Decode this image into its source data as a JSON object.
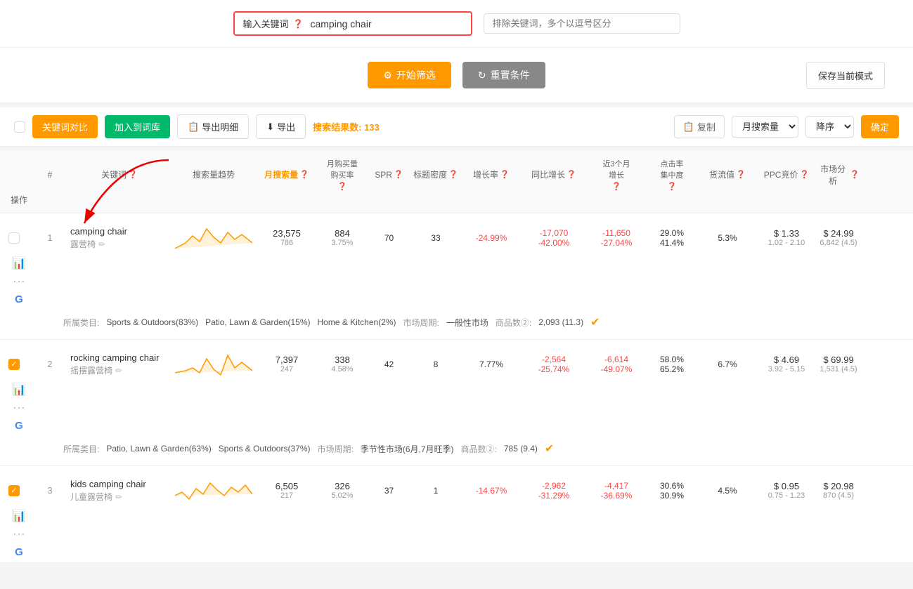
{
  "search": {
    "label": "输入关键词",
    "value": "camping chair",
    "exclude_placeholder": "排除关键词，多个以逗号区分"
  },
  "buttons": {
    "filter": "开始筛选",
    "reset": "重置条件",
    "save": "保存当前模式",
    "compare": "关键词对比",
    "add_vocab": "加入到词库",
    "export_detail": "导出明细",
    "export": "导出",
    "copy": "复制",
    "confirm": "确定",
    "filter_icon": "⚙",
    "reset_icon": "↻"
  },
  "toolbar": {
    "search_count_label": "搜索结果数:",
    "search_count": "133",
    "sort_by": "月搜索量",
    "order": "降序"
  },
  "table": {
    "headers": [
      "#",
      "关键词",
      "搜索量趋势",
      "月搜索量",
      "月购买量购买率",
      "SPR",
      "标题密度",
      "增长率",
      "同比增长",
      "近3个月增长",
      "点击集中度",
      "货流值",
      "PPC竞价",
      "市场分析",
      "操作"
    ],
    "rows": [
      {
        "id": 1,
        "checked": false,
        "keyword_en": "camping chair",
        "keyword_cn": "露营椅",
        "search_vol_main": "23,575",
        "search_vol_sub": "786",
        "buy_vol": "884",
        "buy_rate": "3.75%",
        "spr": "70",
        "title_density": "33",
        "growth_rate": "-24.99%",
        "yoy_main": "-17,070",
        "yoy_sub": "-42.00%",
        "q3_main": "-11,650",
        "q3_sub": "-27.04%",
        "click_concentration": "29.0%",
        "click_sub": "41.4%",
        "flow_val": "5.3%",
        "ppc_main": "$ 1.33",
        "ppc_range": "1.02 - 2.10",
        "market_main": "$ 24.99",
        "market_sub": "6,842 (4.5)",
        "categories": "Sports & Outdoors(83%)  Patio, Lawn & Garden(15%)  Home & Kitchen(2%)",
        "market_period": "一般性市场",
        "goods_count": "2,093 (11.3)"
      },
      {
        "id": 2,
        "checked": true,
        "keyword_en": "rocking camping chair",
        "keyword_cn": "摇摆露营椅",
        "search_vol_main": "7,397",
        "search_vol_sub": "247",
        "buy_vol": "338",
        "buy_rate": "4.58%",
        "spr": "42",
        "title_density": "8",
        "growth_rate": "7.77%",
        "yoy_main": "-2,564",
        "yoy_sub": "-25.74%",
        "q3_main": "-6,614",
        "q3_sub": "-49.07%",
        "click_concentration": "58.0%",
        "click_sub": "65.2%",
        "flow_val": "6.7%",
        "ppc_main": "$ 4.69",
        "ppc_range": "3.92 - 5.15",
        "market_main": "$ 69.99",
        "market_sub": "1,531 (4.5)",
        "categories": "Patio, Lawn & Garden(63%)  Sports & Outdoors(37%)",
        "market_period": "季节性市场(6月,7月旺季)",
        "goods_count": "785 (9.4)"
      },
      {
        "id": 3,
        "checked": true,
        "keyword_en": "kids camping chair",
        "keyword_cn": "儿童露营椅",
        "search_vol_main": "6,505",
        "search_vol_sub": "217",
        "buy_vol": "326",
        "buy_rate": "5.02%",
        "spr": "37",
        "title_density": "1",
        "growth_rate": "-14.67%",
        "yoy_main": "-2,962",
        "yoy_sub": "-31.29%",
        "q3_main": "-4,417",
        "q3_sub": "-36.69%",
        "click_concentration": "30.6%",
        "click_sub": "30.9%",
        "flow_val": "4.5%",
        "ppc_main": "$ 0.95",
        "ppc_range": "0.75 - 1.23",
        "market_main": "$ 20.98",
        "market_sub": "870 (4.5)",
        "categories": "",
        "market_period": "",
        "goods_count": ""
      }
    ]
  }
}
